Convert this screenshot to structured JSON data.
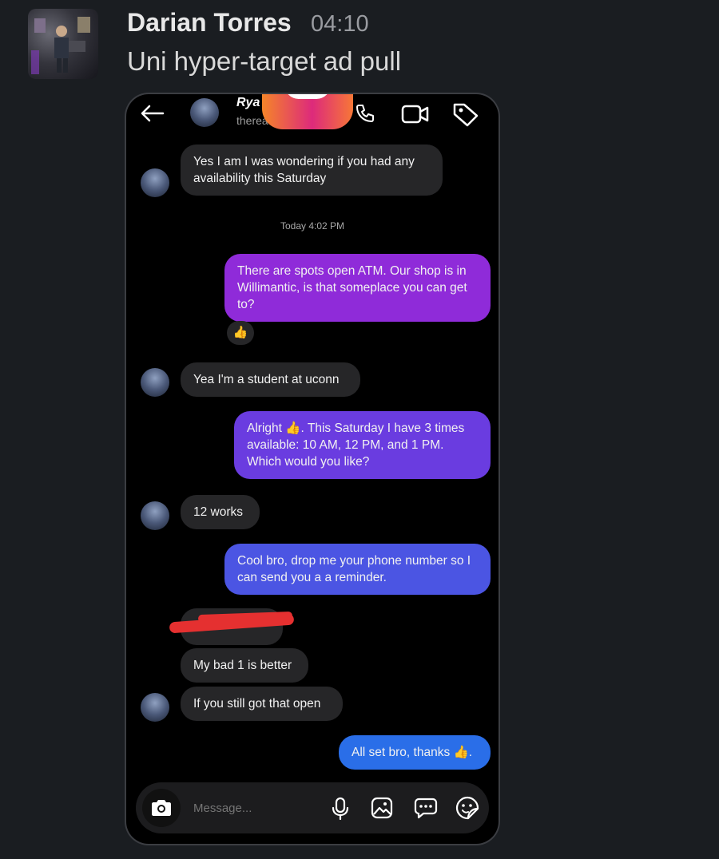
{
  "post": {
    "author": "Darian Torres",
    "time": "04:10",
    "text": "Uni hyper-target ad pull"
  },
  "chat": {
    "header_name": "Rya",
    "header_sub": "therea",
    "timestamp": "Today 4:02 PM",
    "messages": [
      {
        "from": "them",
        "text": "Yes I am I was wondering if you had any availability this Saturday"
      },
      {
        "from": "me",
        "text": "There are spots open ATM. Our shop is in Willimantic, is that someplace you can get to?",
        "color": "#8f2bd9"
      },
      {
        "from": "them",
        "text": "Yea I'm a student at uconn"
      },
      {
        "from": "me",
        "text": "Alright 👍. This Saturday I have 3 times available: 10 AM, 12 PM, and 1 PM. Which would you like?",
        "color": "#6a3ce0"
      },
      {
        "from": "them",
        "text": "12 works"
      },
      {
        "from": "me",
        "text": "Cool bro, drop me your phone number so I can send you a a reminder.",
        "color": "#4b55e3"
      },
      {
        "from": "them",
        "text": "My bad 1 is better"
      },
      {
        "from": "them",
        "text": "If you still got that open"
      },
      {
        "from": "me",
        "text": "All set bro, thanks 👍.",
        "color": "#2a6ee8"
      }
    ],
    "reaction": "👍",
    "input_placeholder": "Message..."
  },
  "icons": [
    "back-arrow-icon",
    "phone-icon",
    "video-icon",
    "tag-icon",
    "camera-icon",
    "mic-icon",
    "gallery-icon",
    "chat-bubble-icon",
    "sticker-icon"
  ]
}
